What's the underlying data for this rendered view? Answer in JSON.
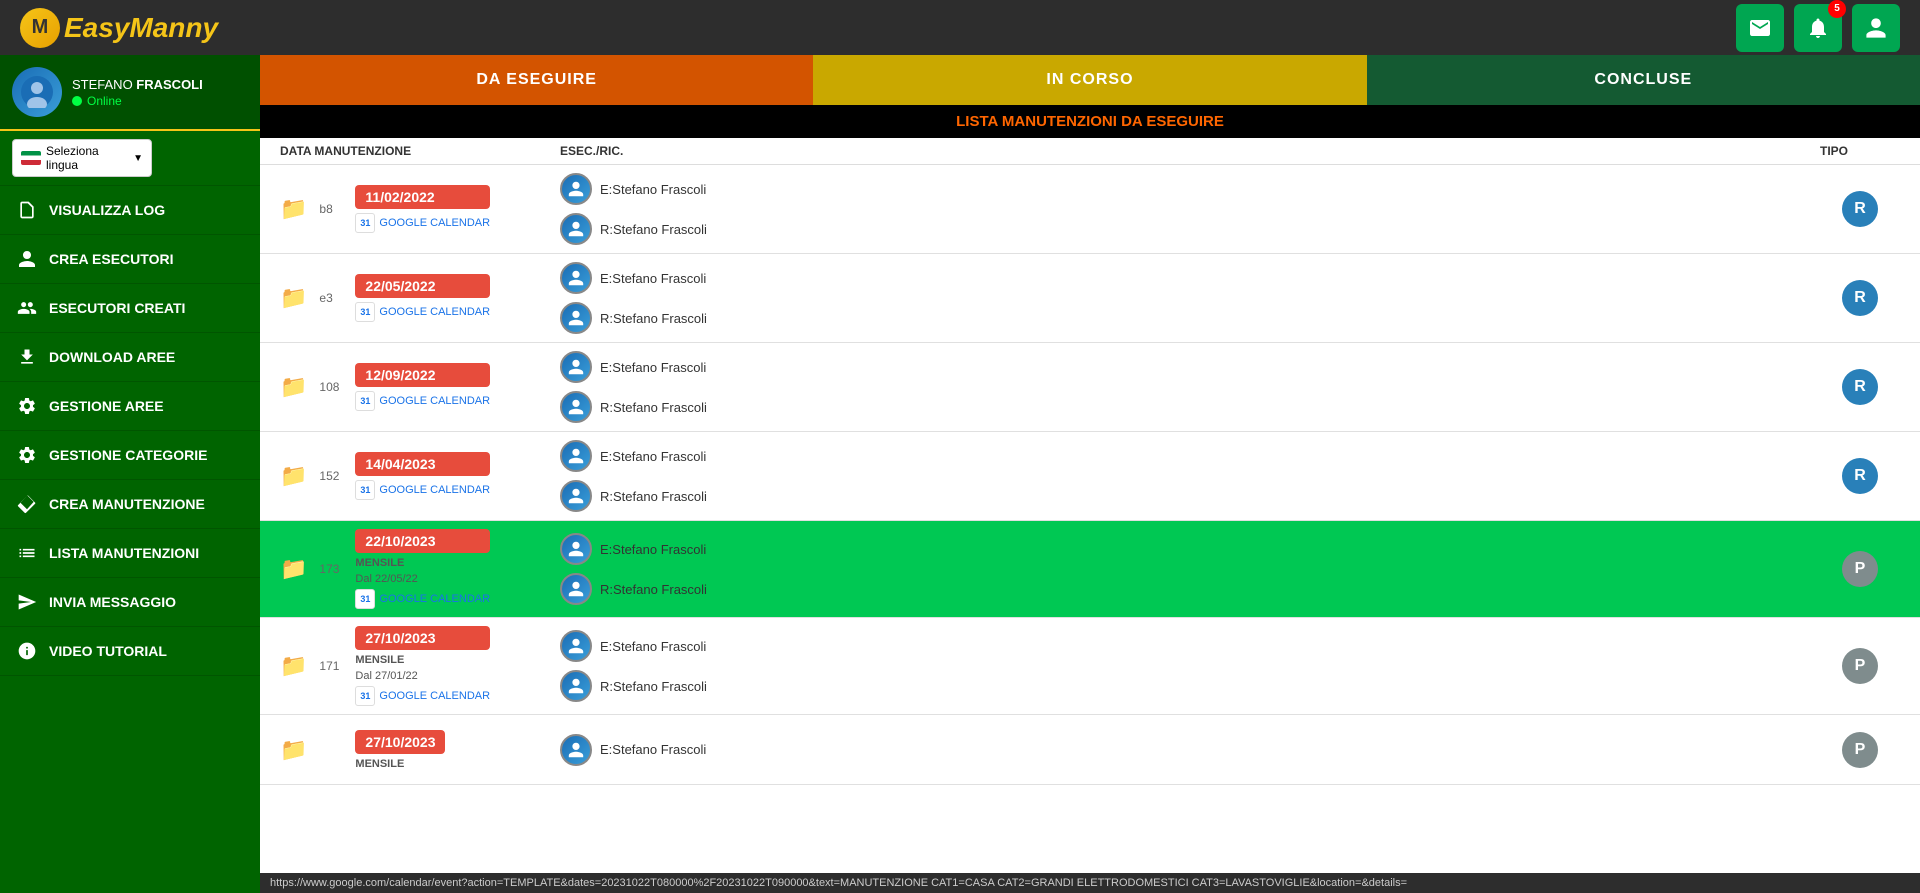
{
  "app": {
    "name_easy": "Easy",
    "name_manny": "Manny"
  },
  "header": {
    "mail_icon": "✉",
    "bell_icon": "🔔",
    "bell_badge": "5",
    "user_icon": "👤"
  },
  "sidebar": {
    "user": {
      "first_name": "STEFANO",
      "last_name": "FRASCOLI",
      "status": "Online"
    },
    "lang_label": "Seleziona lingua",
    "nav_items": [
      {
        "id": "visualizza-log",
        "label": "VISUALIZZA LOG",
        "icon": "📋"
      },
      {
        "id": "crea-esecutori",
        "label": "CREA ESECUTORI",
        "icon": "👤"
      },
      {
        "id": "esecutori-creati",
        "label": "ESECUTORI CREATI",
        "icon": "👥"
      },
      {
        "id": "download-aree",
        "label": "DOWNLOAD AREE",
        "icon": "⬇"
      },
      {
        "id": "gestione-aree",
        "label": "GESTIONE AREE",
        "icon": "⚙"
      },
      {
        "id": "gestione-categorie",
        "label": "GESTIONE CATEGORIE",
        "icon": "⚙"
      },
      {
        "id": "crea-manutenzione",
        "label": "CREA MANUTENZIONE",
        "icon": "🔧"
      },
      {
        "id": "lista-manutenzioni",
        "label": "LISTA MANUTENZIONI",
        "icon": "☰"
      },
      {
        "id": "invia-messaggio",
        "label": "INVIA MESSAGGIO",
        "icon": "⬆"
      },
      {
        "id": "video-tutorial",
        "label": "VIDEO TUTORIAL",
        "icon": "ℹ"
      }
    ]
  },
  "tabs": [
    {
      "id": "da-eseguire",
      "label": "DA ESEGUIRE",
      "active": true
    },
    {
      "id": "in-corso",
      "label": "IN CORSO"
    },
    {
      "id": "concluse",
      "label": "CONCLUSE"
    }
  ],
  "list": {
    "title": "LISTA MANUTENZIONI DA ESEGUIRE",
    "col_data_manutenzione": "DATA MANUTENZIONE",
    "col_esec_ric": "ESEC./RIC.",
    "col_tipo": "TIPO"
  },
  "rows": [
    {
      "id": 1,
      "num": "b8",
      "date": "11/02/2022",
      "mensile": "",
      "dal": "",
      "gcal_label": "GOOGLE CALENDAR",
      "exec_e": "E:Stefano Frascoli",
      "exec_r": "R:Stefano Frascoli",
      "tipo": "R",
      "tipo_class": "r-badge",
      "highlight": false
    },
    {
      "id": 2,
      "num": "e3",
      "date": "22/05/2022",
      "mensile": "",
      "dal": "",
      "gcal_label": "GOOGLE CALENDAR",
      "exec_e": "E:Stefano Frascoli",
      "exec_r": "R:Stefano Frascoli",
      "tipo": "R",
      "tipo_class": "r-badge",
      "highlight": false
    },
    {
      "id": 3,
      "num": "108",
      "date": "12/09/2022",
      "mensile": "",
      "dal": "",
      "gcal_label": "GOOGLE CALENDAR",
      "exec_e": "E:Stefano Frascoli",
      "exec_r": "R:Stefano Frascoli",
      "tipo": "R",
      "tipo_class": "r-badge",
      "highlight": false
    },
    {
      "id": 4,
      "num": "152",
      "date": "14/04/2023",
      "mensile": "",
      "dal": "",
      "gcal_label": "GOOGLE CALENDAR",
      "exec_e": "E:Stefano Frascoli",
      "exec_r": "R:Stefano Frascoli",
      "tipo": "R",
      "tipo_class": "r-badge",
      "highlight": false
    },
    {
      "id": 5,
      "num": "173",
      "date": "22/10/2023",
      "mensile": "MENSILE",
      "dal": "Dal 22/05/22",
      "gcal_label": "GOOGLE CALENDAR",
      "exec_e": "E:Stefano Frascoli",
      "exec_r": "R:Stefano Frascoli",
      "tipo": "P",
      "tipo_class": "p-badge",
      "highlight": true
    },
    {
      "id": 6,
      "num": "171",
      "date": "27/10/2023",
      "mensile": "MENSILE",
      "dal": "Dal 27/01/22",
      "gcal_label": "GOOGLE CALENDAR",
      "exec_e": "E:Stefano Frascoli",
      "exec_r": "R:Stefano Frascoli",
      "tipo": "P",
      "tipo_class": "p-badge",
      "highlight": false
    },
    {
      "id": 7,
      "num": "",
      "date": "27/10/2023",
      "mensile": "MENSILE",
      "dal": "",
      "gcal_label": "",
      "exec_e": "E:Stefano Frascoli",
      "exec_r": "",
      "tipo": "P",
      "tipo_class": "p-badge",
      "highlight": false
    }
  ],
  "statusbar": {
    "url": "https://www.google.com/calendar/event?action=TEMPLATE&dates=20231022T080000%2F20231022T090000&text=MANUTENZIONE CAT1=CASA CAT2=GRANDI ELETTRODOMESTICI CAT3=LAVASTOVIGLIE&location=&details="
  }
}
